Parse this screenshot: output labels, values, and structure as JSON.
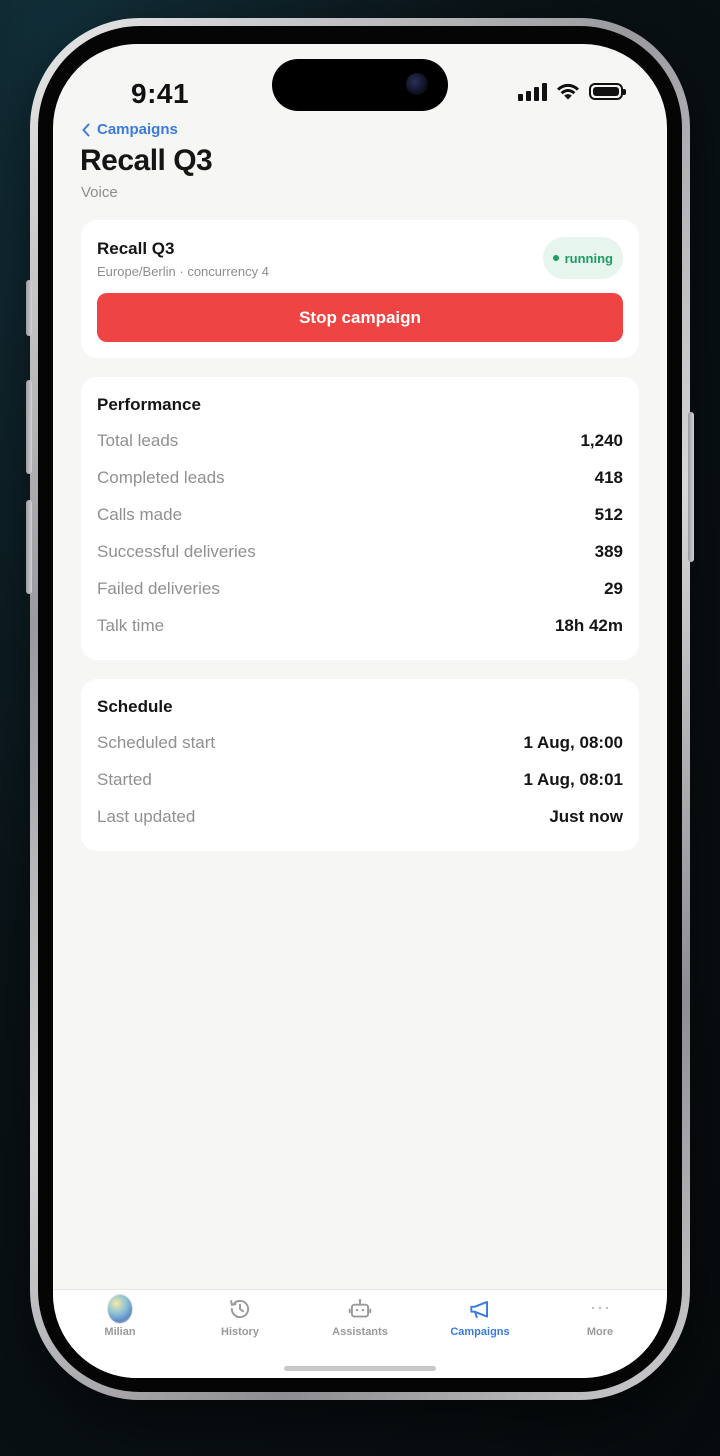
{
  "status_bar": {
    "time": "9:41"
  },
  "nav": {
    "back_label": "Campaigns"
  },
  "page": {
    "title": "Recall Q3",
    "subtitle": "Voice"
  },
  "campaign_card": {
    "name": "Recall Q3",
    "meta": "Europe/Berlin · concurrency 4",
    "status": "running",
    "stop_label": "Stop campaign"
  },
  "performance": {
    "title": "Performance",
    "rows": [
      {
        "label": "Total leads",
        "value": "1,240"
      },
      {
        "label": "Completed leads",
        "value": "418"
      },
      {
        "label": "Calls made",
        "value": "512"
      },
      {
        "label": "Successful deliveries",
        "value": "389"
      },
      {
        "label": "Failed deliveries",
        "value": "29"
      },
      {
        "label": "Talk time",
        "value": "18h 42m"
      }
    ]
  },
  "schedule": {
    "title": "Schedule",
    "rows": [
      {
        "label": "Scheduled start",
        "value": "1 Aug, 08:00"
      },
      {
        "label": "Started",
        "value": "1 Aug, 08:01"
      },
      {
        "label": "Last updated",
        "value": "Just now"
      }
    ]
  },
  "tab_bar": {
    "items": [
      {
        "label": "Milian",
        "icon": "avatar"
      },
      {
        "label": "History",
        "icon": "history-icon"
      },
      {
        "label": "Assistants",
        "icon": "robot-icon"
      },
      {
        "label": "Campaigns",
        "icon": "megaphone-icon",
        "active": true
      },
      {
        "label": "More",
        "icon": "more-icon"
      }
    ]
  },
  "colors": {
    "accent": "#3a7be0",
    "danger": "#ef4444",
    "success": "#1f9d63",
    "success_bg": "#e6f5ee",
    "background": "#f6f6f4"
  }
}
